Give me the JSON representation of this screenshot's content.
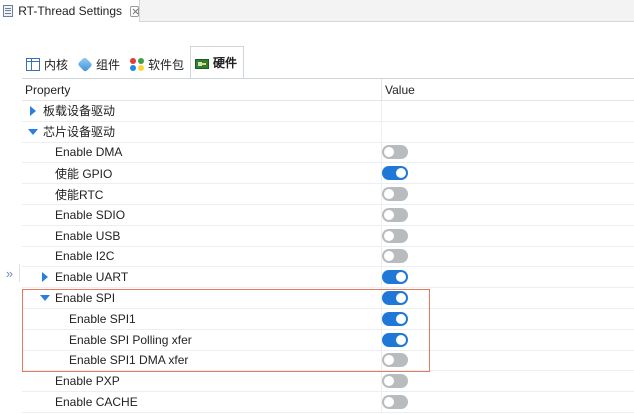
{
  "editor": {
    "tab_title": "RT-Thread Settings"
  },
  "settings_tabs": [
    {
      "label": "内核",
      "icon": "table-icon",
      "active": false
    },
    {
      "label": "组件",
      "icon": "cube-icon",
      "active": false
    },
    {
      "label": "软件包",
      "icon": "package-icon",
      "active": false
    },
    {
      "label": "硬件",
      "icon": "board-icon",
      "active": true
    }
  ],
  "table": {
    "header_property": "Property",
    "header_value": "Value",
    "rows": [
      {
        "label": "板载设备驱动",
        "twisty": "collapsed",
        "level": 0,
        "toggle": null
      },
      {
        "label": "芯片设备驱动",
        "twisty": "expanded",
        "level": 0,
        "toggle": null
      },
      {
        "label": "Enable DMA",
        "twisty": null,
        "level": 1,
        "toggle": "off"
      },
      {
        "label": "使能 GPIO",
        "twisty": null,
        "level": 1,
        "toggle": "on"
      },
      {
        "label": "使能RTC",
        "twisty": null,
        "level": 1,
        "toggle": "off"
      },
      {
        "label": "Enable SDIO",
        "twisty": null,
        "level": 1,
        "toggle": "off"
      },
      {
        "label": "Enable USB",
        "twisty": null,
        "level": 1,
        "toggle": "off"
      },
      {
        "label": "Enable I2C",
        "twisty": null,
        "level": 1,
        "toggle": "off"
      },
      {
        "label": "Enable UART",
        "twisty": "collapsed",
        "level": 1,
        "toggle": "on"
      },
      {
        "label": "Enable SPI",
        "twisty": "expanded",
        "level": 1,
        "toggle": "on"
      },
      {
        "label": "Enable SPI1",
        "twisty": null,
        "level": 2,
        "toggle": "on"
      },
      {
        "label": "Enable SPI Polling xfer",
        "twisty": null,
        "level": 2,
        "toggle": "on"
      },
      {
        "label": "Enable SPI1 DMA xfer",
        "twisty": null,
        "level": 2,
        "toggle": "off"
      },
      {
        "label": "Enable PXP",
        "twisty": null,
        "level": 1,
        "toggle": "off"
      },
      {
        "label": "Enable CACHE",
        "twisty": null,
        "level": 1,
        "toggle": "off"
      }
    ]
  },
  "colors": {
    "toggle_on": "#1f78d7",
    "toggle_off": "#b9bcbf",
    "twisty": "#2a7de1",
    "highlight": "#e8795f"
  }
}
